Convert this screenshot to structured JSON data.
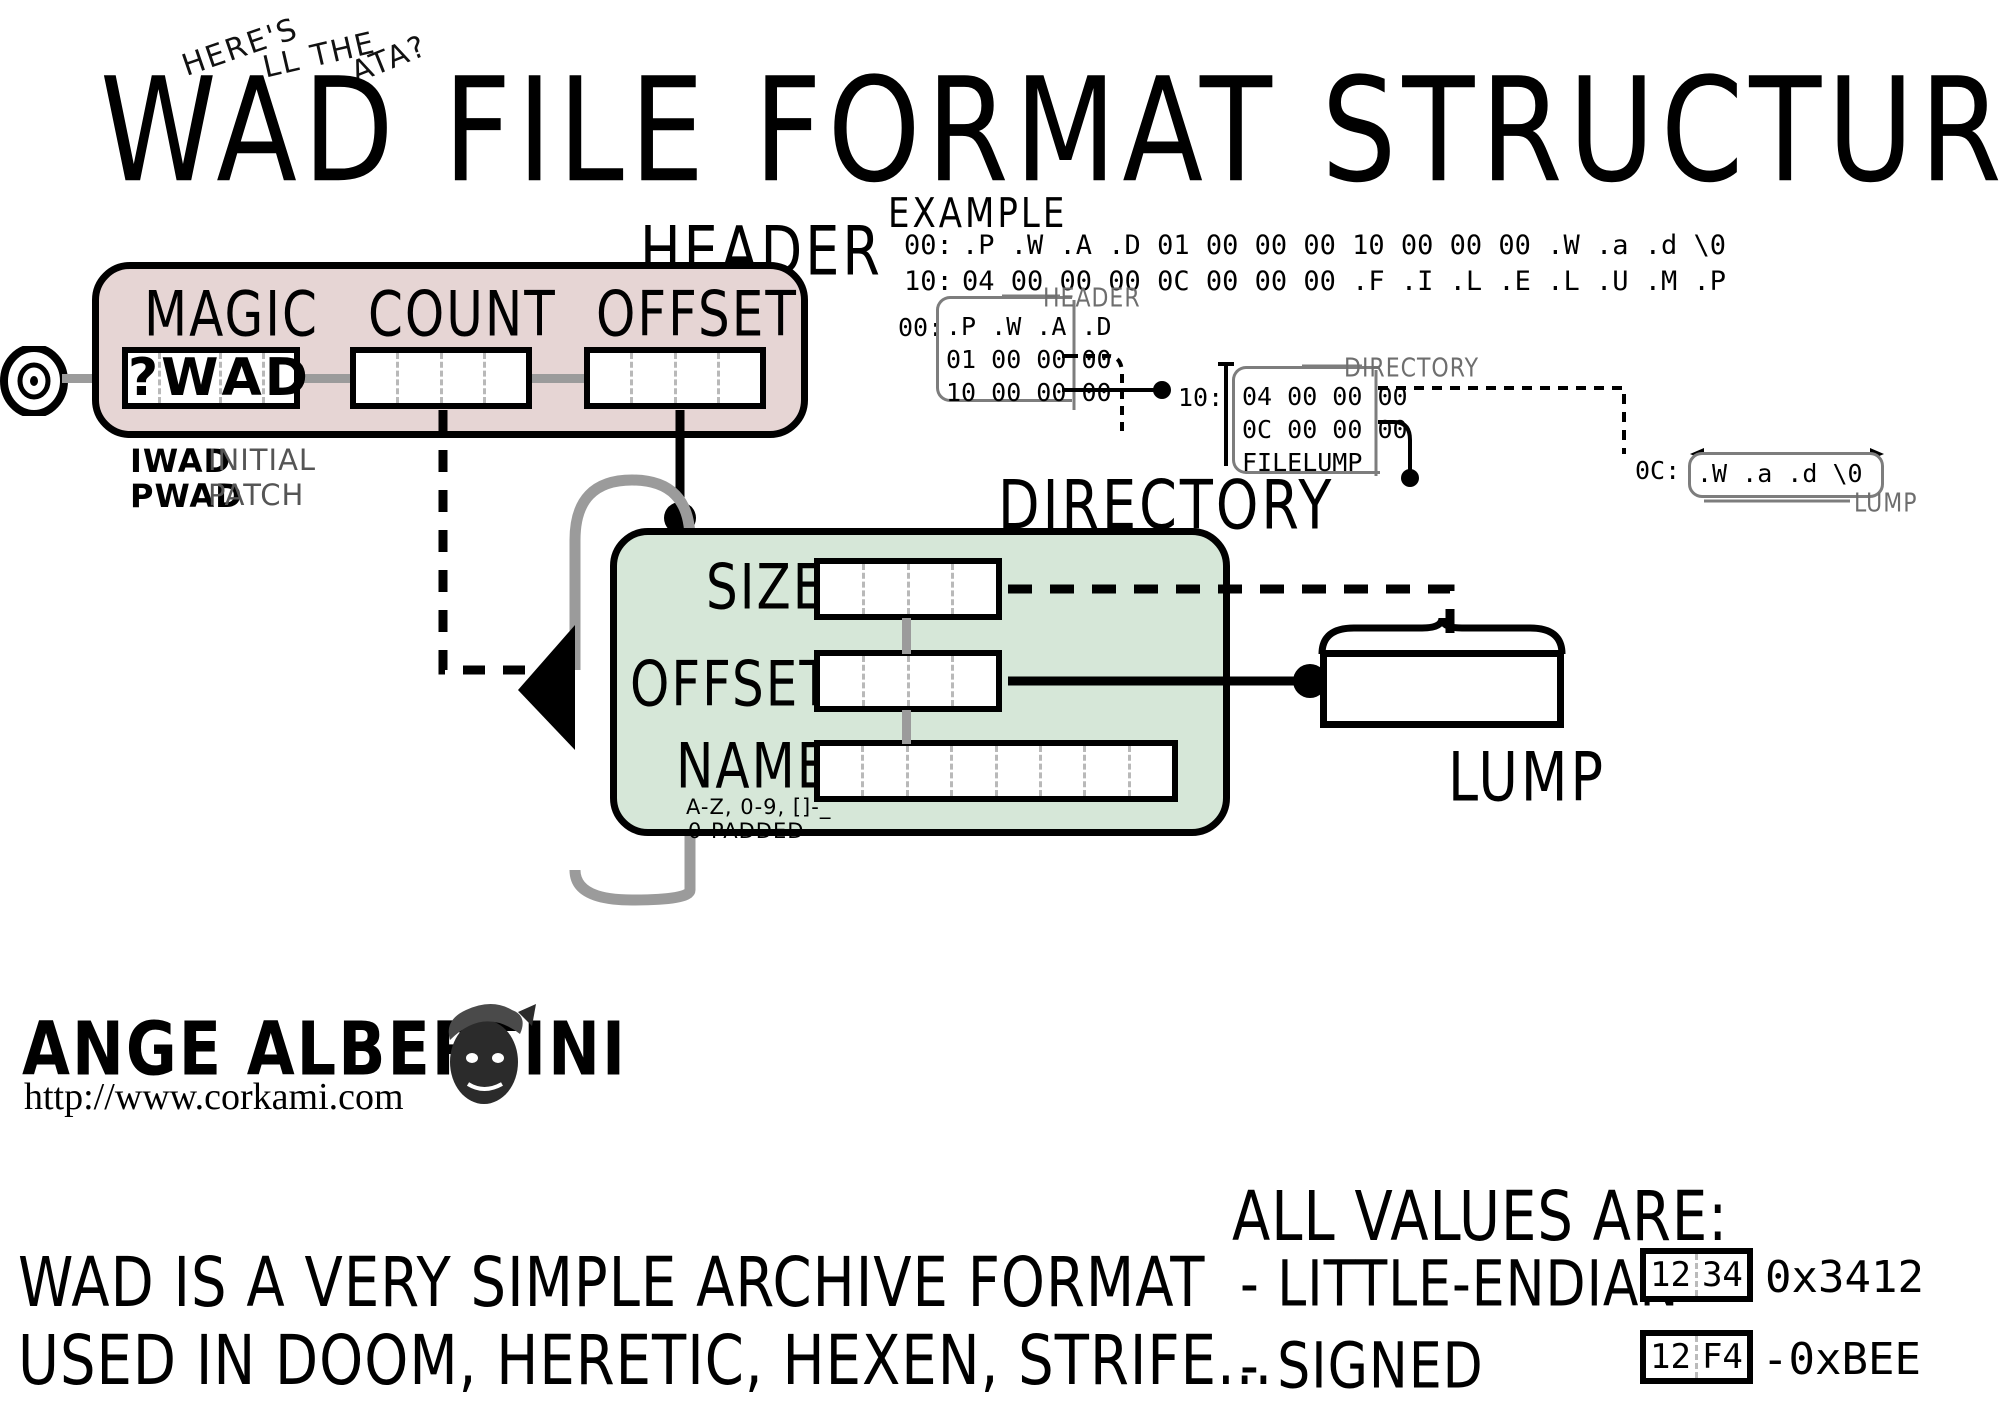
{
  "title": {
    "main": "WAD FILE FORMAT STRUCTURE",
    "joke_a": "HERE'S",
    "joke_b": "LL THE",
    "joke_c": "ATA?"
  },
  "header": {
    "section_label": "HEADER",
    "start_offset": "0",
    "fields": [
      {
        "label": "MAGIC",
        "cells": [
          "?",
          "W",
          "A",
          "D"
        ]
      },
      {
        "label": "COUNT",
        "cells": [
          "",
          "",
          "",
          ""
        ]
      },
      {
        "label": "OFFSET",
        "cells": [
          "",
          "",
          "",
          ""
        ]
      }
    ],
    "legend": [
      {
        "code": "IWAD",
        "meaning": "INITIAL"
      },
      {
        "code": "PWAD",
        "meaning": "PATCH"
      }
    ],
    "bg_color": "#e6d5d4"
  },
  "directory": {
    "section_label": "DIRECTORY",
    "fields": [
      {
        "label": "SIZE",
        "cells": [
          "",
          "",
          "",
          ""
        ]
      },
      {
        "label": "OFFSET",
        "cells": [
          "",
          "",
          "",
          ""
        ]
      },
      {
        "label": "NAME",
        "cells": [
          "",
          "",
          "",
          "",
          "",
          "",
          "",
          ""
        ]
      }
    ],
    "name_note_1": "A-Z, 0-9, []-_",
    "name_note_2": "0-PADDED",
    "bg_color": "#d6e7d8"
  },
  "lump": {
    "label": "LUMP"
  },
  "example": {
    "title": "EXAMPLE",
    "hex_rows": [
      {
        "addr": "00:",
        "bytes": ".P .W .A .D 01 00 00 00 10 00 00 00 .W .a .d \\0"
      },
      {
        "addr": "10:",
        "bytes": "04 00 00 00 0C 00 00 00 .F .I .L .E .L .U .M .P"
      }
    ],
    "header_block": {
      "label": "HEADER",
      "addr": "00:",
      "lines": [
        ".P .W .A .D",
        "01 00 00 00",
        "10 00 00 00"
      ]
    },
    "directory_block": {
      "label": "DIRECTORY",
      "addr": "10:",
      "lines": [
        "04 00 00 00",
        "0C 00 00 00",
        "FILELUMP"
      ]
    },
    "lump_block": {
      "label": "LUMP",
      "addr": "0C:",
      "line": ".W .a .d \\0"
    }
  },
  "signature": {
    "name": "ANGE ALBERTINI",
    "url": "http://www.corkami.com"
  },
  "footer": {
    "desc_line_1": "WAD IS A VERY SIMPLE ARCHIVE FORMAT",
    "desc_line_2": "USED IN DOOM, HERETIC, HEXEN, STRIFE...",
    "values_title": "ALL VALUES ARE:",
    "values": [
      {
        "bullet": "- LITTLE-ENDIAN",
        "byte_low": "12",
        "byte_high": "34",
        "result": "0x3412"
      },
      {
        "bullet": "- SIGNED",
        "byte_low": "12",
        "byte_high": "F4",
        "result": "-0xBEE"
      }
    ]
  }
}
